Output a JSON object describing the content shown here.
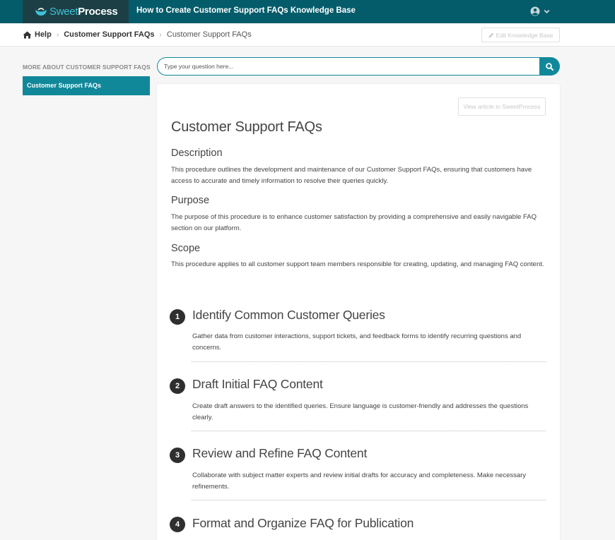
{
  "header": {
    "logo_part1": "Sweet",
    "logo_part2": "Process",
    "title": "How to Create Customer Support FAQs Knowledge Base",
    "user_icon": "user-circle-icon",
    "chevron_icon": "chevron-down-icon"
  },
  "breadcrumb": {
    "home_label": "Help",
    "items": [
      "Customer Support FAQs",
      "Customer Support FAQs"
    ]
  },
  "toolbar": {
    "edit_label": "Edit Knowledge Base"
  },
  "sidebar": {
    "heading": "MORE ABOUT CUSTOMER SUPPORT FAQS",
    "items": [
      {
        "label": "Customer Support FAQs",
        "active": true
      }
    ]
  },
  "search": {
    "placeholder": "Type your question here...",
    "value": ""
  },
  "article": {
    "view_label": "View article in SweetProcess",
    "title": "Customer Support FAQs",
    "sections": [
      {
        "heading": "Description",
        "text": "This procedure outlines the development and maintenance of our Customer Support FAQs, ensuring that customers have access to accurate and timely information to resolve their queries quickly."
      },
      {
        "heading": "Purpose",
        "text": "The purpose of this procedure is to enhance customer satisfaction by providing a comprehensive and easily navigable FAQ section on our platform."
      },
      {
        "heading": "Scope",
        "text": "This procedure applies to all customer support team members responsible for creating, updating, and managing FAQ content."
      }
    ],
    "steps": [
      {
        "num": "1",
        "title": "Identify Common Customer Queries",
        "text": "Gather data from customer interactions, support tickets, and feedback forms to identify recurring questions and concerns."
      },
      {
        "num": "2",
        "title": "Draft Initial FAQ Content",
        "text": "Create draft answers to the identified queries. Ensure language is customer-friendly and addresses the questions clearly."
      },
      {
        "num": "3",
        "title": "Review and Refine FAQ Content",
        "text": "Collaborate with subject matter experts and review initial drafts for accuracy and completeness. Make necessary refinements."
      },
      {
        "num": "4",
        "title": "Format and Organize FAQ for Publication",
        "text": ""
      }
    ]
  },
  "colors": {
    "topbar": "#045c6b",
    "logo_bg": "#1c3f46",
    "accent": "#11889a",
    "step_badge": "#2f2f2f"
  }
}
